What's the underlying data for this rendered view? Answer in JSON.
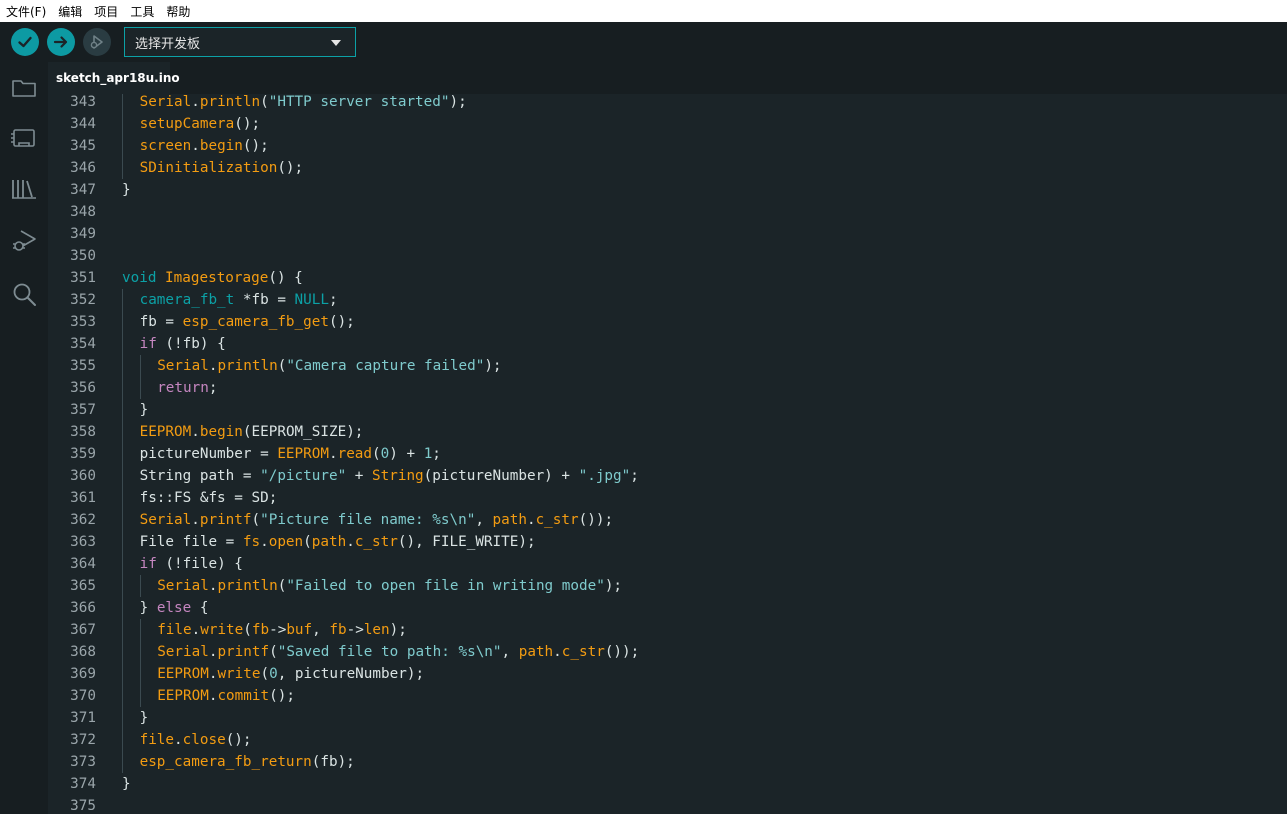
{
  "menu": [
    "文件(F)",
    "编辑",
    "项目",
    "工具",
    "帮助"
  ],
  "toolbar": {
    "board_select": "选择开发板"
  },
  "tab": {
    "label": "sketch_apr18u.ino"
  },
  "colors": {
    "accent": "#0CA1A6",
    "background": "#1B2428",
    "chrome": "#171E21",
    "function": "#F39C12",
    "keyword": "#C586C0",
    "string": "#7FCBCD"
  },
  "code_lines": [
    {
      "n": "343",
      "indent": 1,
      "tokens": [
        [
          "fn",
          "Serial"
        ],
        [
          "plain",
          "."
        ],
        [
          "fn",
          "println"
        ],
        [
          "plain",
          "("
        ],
        [
          "str",
          "\"HTTP server started\""
        ],
        [
          "plain",
          ");"
        ]
      ]
    },
    {
      "n": "344",
      "indent": 1,
      "tokens": [
        [
          "fn",
          "setupCamera"
        ],
        [
          "plain",
          "();"
        ]
      ]
    },
    {
      "n": "345",
      "indent": 1,
      "tokens": [
        [
          "fn",
          "screen"
        ],
        [
          "plain",
          "."
        ],
        [
          "fn",
          "begin"
        ],
        [
          "plain",
          "();"
        ]
      ]
    },
    {
      "n": "346",
      "indent": 1,
      "tokens": [
        [
          "fn",
          "SDinitialization"
        ],
        [
          "plain",
          "();"
        ]
      ]
    },
    {
      "n": "347",
      "indent": 0,
      "tokens": [
        [
          "plain",
          "}"
        ]
      ]
    },
    {
      "n": "348",
      "indent": 0,
      "tokens": []
    },
    {
      "n": "349",
      "indent": 0,
      "tokens": []
    },
    {
      "n": "350",
      "indent": 0,
      "tokens": []
    },
    {
      "n": "351",
      "indent": 0,
      "tokens": [
        [
          "ty",
          "void"
        ],
        [
          "plain",
          " "
        ],
        [
          "fn",
          "Imagestorage"
        ],
        [
          "plain",
          "() {"
        ]
      ]
    },
    {
      "n": "352",
      "indent": 1,
      "tokens": [
        [
          "ty",
          "camera_fb_t"
        ],
        [
          "plain",
          " *fb = "
        ],
        [
          "const",
          "NULL"
        ],
        [
          "plain",
          ";"
        ]
      ]
    },
    {
      "n": "353",
      "indent": 1,
      "tokens": [
        [
          "plain",
          "fb = "
        ],
        [
          "fn",
          "esp_camera_fb_get"
        ],
        [
          "plain",
          "();"
        ]
      ]
    },
    {
      "n": "354",
      "indent": 1,
      "tokens": [
        [
          "kw",
          "if"
        ],
        [
          "plain",
          " (!fb) {"
        ]
      ]
    },
    {
      "n": "355",
      "indent": 2,
      "tokens": [
        [
          "fn",
          "Serial"
        ],
        [
          "plain",
          "."
        ],
        [
          "fn",
          "println"
        ],
        [
          "plain",
          "("
        ],
        [
          "str",
          "\"Camera capture failed\""
        ],
        [
          "plain",
          ");"
        ]
      ]
    },
    {
      "n": "356",
      "indent": 2,
      "tokens": [
        [
          "kw",
          "return"
        ],
        [
          "plain",
          ";"
        ]
      ]
    },
    {
      "n": "357",
      "indent": 1,
      "tokens": [
        [
          "plain",
          "}"
        ]
      ]
    },
    {
      "n": "358",
      "indent": 1,
      "tokens": [
        [
          "fn",
          "EEPROM"
        ],
        [
          "plain",
          "."
        ],
        [
          "fn",
          "begin"
        ],
        [
          "plain",
          "(EEPROM_SIZE);"
        ]
      ]
    },
    {
      "n": "359",
      "indent": 1,
      "tokens": [
        [
          "plain",
          "pictureNumber = "
        ],
        [
          "fn",
          "EEPROM"
        ],
        [
          "plain",
          "."
        ],
        [
          "fn",
          "read"
        ],
        [
          "plain",
          "("
        ],
        [
          "num",
          "0"
        ],
        [
          "plain",
          ") + "
        ],
        [
          "num",
          "1"
        ],
        [
          "plain",
          ";"
        ]
      ]
    },
    {
      "n": "360",
      "indent": 1,
      "tokens": [
        [
          "plain",
          "String path = "
        ],
        [
          "str",
          "\"/picture\""
        ],
        [
          "plain",
          " + "
        ],
        [
          "fn",
          "String"
        ],
        [
          "plain",
          "(pictureNumber) + "
        ],
        [
          "str",
          "\".jpg\""
        ],
        [
          "plain",
          ";"
        ]
      ]
    },
    {
      "n": "361",
      "indent": 1,
      "tokens": [
        [
          "plain",
          "fs::FS &fs = SD;"
        ]
      ]
    },
    {
      "n": "362",
      "indent": 1,
      "tokens": [
        [
          "fn",
          "Serial"
        ],
        [
          "plain",
          "."
        ],
        [
          "fn",
          "printf"
        ],
        [
          "plain",
          "("
        ],
        [
          "str",
          "\"Picture file name: %s\\n\""
        ],
        [
          "plain",
          ", "
        ],
        [
          "fn",
          "path"
        ],
        [
          "plain",
          "."
        ],
        [
          "fn",
          "c_str"
        ],
        [
          "plain",
          "());"
        ]
      ]
    },
    {
      "n": "363",
      "indent": 1,
      "tokens": [
        [
          "plain",
          "File file = "
        ],
        [
          "fn",
          "fs"
        ],
        [
          "plain",
          "."
        ],
        [
          "fn",
          "open"
        ],
        [
          "plain",
          "("
        ],
        [
          "fn",
          "path"
        ],
        [
          "plain",
          "."
        ],
        [
          "fn",
          "c_str"
        ],
        [
          "plain",
          "(), FILE_WRITE);"
        ]
      ]
    },
    {
      "n": "364",
      "indent": 1,
      "tokens": [
        [
          "kw",
          "if"
        ],
        [
          "plain",
          " (!file) {"
        ]
      ]
    },
    {
      "n": "365",
      "indent": 2,
      "tokens": [
        [
          "fn",
          "Serial"
        ],
        [
          "plain",
          "."
        ],
        [
          "fn",
          "println"
        ],
        [
          "plain",
          "("
        ],
        [
          "str",
          "\"Failed to open file in writing mode\""
        ],
        [
          "plain",
          ");"
        ]
      ]
    },
    {
      "n": "366",
      "indent": 1,
      "tokens": [
        [
          "plain",
          "} "
        ],
        [
          "kw",
          "else"
        ],
        [
          "plain",
          " {"
        ]
      ]
    },
    {
      "n": "367",
      "indent": 2,
      "tokens": [
        [
          "fn",
          "file"
        ],
        [
          "plain",
          "."
        ],
        [
          "fn",
          "write"
        ],
        [
          "plain",
          "("
        ],
        [
          "fn",
          "fb"
        ],
        [
          "plain",
          "->"
        ],
        [
          "fn",
          "buf"
        ],
        [
          "plain",
          ", "
        ],
        [
          "fn",
          "fb"
        ],
        [
          "plain",
          "->"
        ],
        [
          "fn",
          "len"
        ],
        [
          "plain",
          ");"
        ]
      ]
    },
    {
      "n": "368",
      "indent": 2,
      "tokens": [
        [
          "fn",
          "Serial"
        ],
        [
          "plain",
          "."
        ],
        [
          "fn",
          "printf"
        ],
        [
          "plain",
          "("
        ],
        [
          "str",
          "\"Saved file to path: %s\\n\""
        ],
        [
          "plain",
          ", "
        ],
        [
          "fn",
          "path"
        ],
        [
          "plain",
          "."
        ],
        [
          "fn",
          "c_str"
        ],
        [
          "plain",
          "());"
        ]
      ]
    },
    {
      "n": "369",
      "indent": 2,
      "tokens": [
        [
          "fn",
          "EEPROM"
        ],
        [
          "plain",
          "."
        ],
        [
          "fn",
          "write"
        ],
        [
          "plain",
          "("
        ],
        [
          "num",
          "0"
        ],
        [
          "plain",
          ", pictureNumber);"
        ]
      ]
    },
    {
      "n": "370",
      "indent": 2,
      "tokens": [
        [
          "fn",
          "EEPROM"
        ],
        [
          "plain",
          "."
        ],
        [
          "fn",
          "commit"
        ],
        [
          "plain",
          "();"
        ]
      ]
    },
    {
      "n": "371",
      "indent": 1,
      "tokens": [
        [
          "plain",
          "}"
        ]
      ]
    },
    {
      "n": "372",
      "indent": 1,
      "tokens": [
        [
          "fn",
          "file"
        ],
        [
          "plain",
          "."
        ],
        [
          "fn",
          "close"
        ],
        [
          "plain",
          "();"
        ]
      ]
    },
    {
      "n": "373",
      "indent": 1,
      "tokens": [
        [
          "fn",
          "esp_camera_fb_return"
        ],
        [
          "plain",
          "(fb);"
        ]
      ]
    },
    {
      "n": "374",
      "indent": 0,
      "tokens": [
        [
          "plain",
          "}"
        ]
      ]
    },
    {
      "n": "375",
      "indent": 0,
      "tokens": []
    }
  ]
}
